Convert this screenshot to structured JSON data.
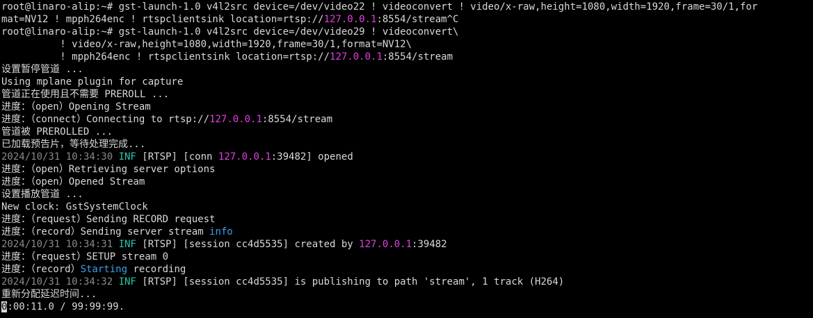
{
  "colors": {
    "background": "#000000",
    "text": "#d9d9d9",
    "timestamp": "#8a8a8a",
    "log_level": "#28c7a8",
    "ip_address": "#e03fe0",
    "keyword": "#3aa0e8"
  },
  "lines": [
    [
      {
        "t": "root@linaro-alip:~# gst-launch-1.0 v4l2src device=/dev/video22 ! videoconvert ! video/x-raw,height=1080,width=1920,frame=30/1,for"
      }
    ],
    [
      {
        "t": "mat=NV12 ! mpph264enc ! rtspclientsink location=rtsp://"
      },
      {
        "t": "127.0.0.1",
        "c": "ip"
      },
      {
        "t": ":8554/stream^C"
      }
    ],
    [
      {
        "t": "root@linaro-alip:~# gst-launch-1.0 v4l2src device=/dev/video29 ! videoconvert\\"
      }
    ],
    [
      {
        "t": "          ! video/x-raw,height=1080,width=1920,frame=30/1,format=NV12\\"
      }
    ],
    [
      {
        "t": "          ! mpph264enc ! rtspclientsink location=rtsp://"
      },
      {
        "t": "127.0.0.1",
        "c": "ip"
      },
      {
        "t": ":8554/stream"
      }
    ],
    [
      {
        "t": "设置暂停管道 ..."
      }
    ],
    [
      {
        "t": "Using mplane plugin for capture"
      }
    ],
    [
      {
        "t": "管道正在使用且不需要 PREROLL ..."
      }
    ],
    [
      {
        "t": "进度：（open）Opening Stream"
      }
    ],
    [
      {
        "t": "进度：（connect）Connecting to rtsp://"
      },
      {
        "t": "127.0.0.1",
        "c": "ip"
      },
      {
        "t": ":8554/stream"
      }
    ],
    [
      {
        "t": "管道被 PREROLLED ..."
      }
    ],
    [
      {
        "t": "已加载预告片，等待处理完成..."
      }
    ],
    [
      {
        "t": "2024/10/31 10:34:30 ",
        "c": "ts"
      },
      {
        "t": "INF",
        "c": "inf"
      },
      {
        "t": " [RTSP] [conn "
      },
      {
        "t": "127.0.0.1",
        "c": "ip"
      },
      {
        "t": ":39482] opened"
      }
    ],
    [
      {
        "t": "进度：（open）Retrieving server options"
      }
    ],
    [
      {
        "t": "进度：（open）Opened Stream"
      }
    ],
    [
      {
        "t": "设置播放管道 ..."
      }
    ],
    [
      {
        "t": "New clock: GstSystemClock"
      }
    ],
    [
      {
        "t": "进度：（request）Sending RECORD request"
      }
    ],
    [
      {
        "t": "进度：（record）Sending server stream "
      },
      {
        "t": "info",
        "c": "kw"
      }
    ],
    [
      {
        "t": "2024/10/31 10:34:31 ",
        "c": "ts"
      },
      {
        "t": "INF",
        "c": "inf"
      },
      {
        "t": " [RTSP] [session cc4d5535] created by "
      },
      {
        "t": "127.0.0.1",
        "c": "ip"
      },
      {
        "t": ":39482"
      }
    ],
    [
      {
        "t": "进度：（request）SETUP stream 0"
      }
    ],
    [
      {
        "t": "进度：（record）"
      },
      {
        "t": "Starting",
        "c": "kw"
      },
      {
        "t": " recording"
      }
    ],
    [
      {
        "t": "2024/10/31 10:34:32 ",
        "c": "ts"
      },
      {
        "t": "INF",
        "c": "inf"
      },
      {
        "t": " [RTSP] [session cc4d5535] is publishing to path 'stream', 1 track (H264)"
      }
    ],
    [
      {
        "t": "重新分配延迟时间..."
      }
    ],
    [
      {
        "t": "0",
        "c": "cursor"
      },
      {
        "t": ":00:11.0 / 99:99:99."
      }
    ]
  ]
}
